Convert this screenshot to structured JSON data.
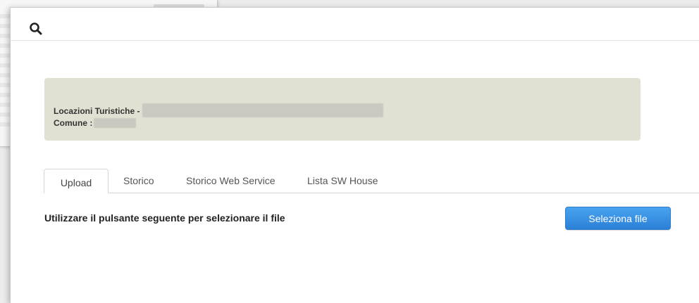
{
  "header": {
    "icon": "search-icon"
  },
  "info_box": {
    "title_label": "Locazioni Turistiche -",
    "comune_label": "Comune :"
  },
  "tabs": [
    {
      "label": "Upload",
      "active": true
    },
    {
      "label": "Storico",
      "active": false
    },
    {
      "label": "Storico Web Service",
      "active": false
    },
    {
      "label": "Lista SW House",
      "active": false
    }
  ],
  "upload": {
    "instruction": "Utilizzare il pulsante seguente per selezionare il file",
    "select_file_button": "Seleziona file"
  },
  "colors": {
    "accent": "#3a92e3",
    "info_box_bg": "#e0e0d3"
  }
}
